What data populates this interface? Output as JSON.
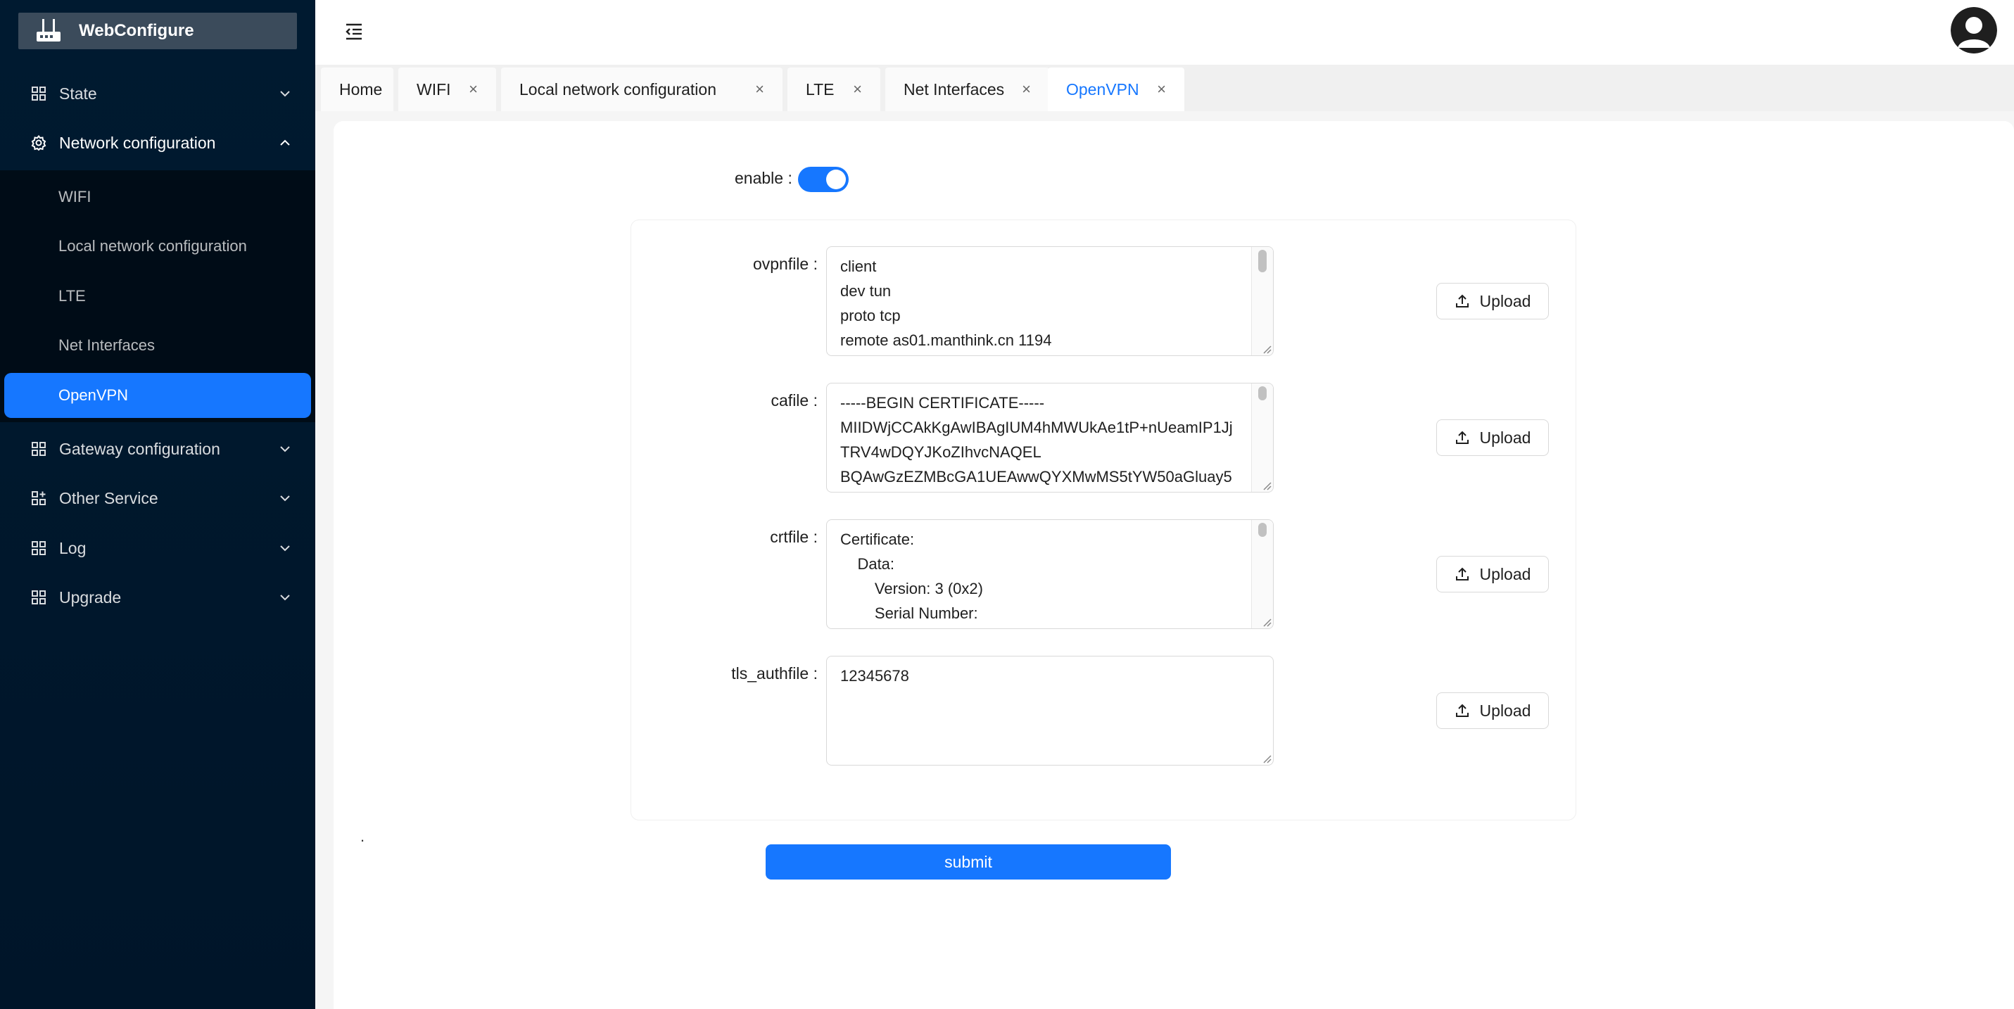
{
  "app": {
    "title": "WebConfigure"
  },
  "sidebar": {
    "menu": [
      {
        "label": "State",
        "expanded": false
      },
      {
        "label": "Network configuration",
        "expanded": true
      },
      {
        "label": "Gateway configuration",
        "expanded": false
      },
      {
        "label": "Other Service",
        "expanded": false
      },
      {
        "label": "Log",
        "expanded": false
      },
      {
        "label": "Upgrade",
        "expanded": false
      }
    ],
    "network_submenu": [
      {
        "label": "WIFI"
      },
      {
        "label": "Local network configuration"
      },
      {
        "label": "LTE"
      },
      {
        "label": "Net Interfaces"
      },
      {
        "label": "OpenVPN",
        "active": true
      }
    ]
  },
  "tabs": [
    {
      "label": "Home",
      "closable": false
    },
    {
      "label": "WIFI",
      "closable": true
    },
    {
      "label": "Local network configuration",
      "closable": true
    },
    {
      "label": "LTE",
      "closable": true
    },
    {
      "label": "Net Interfaces",
      "closable": true
    },
    {
      "label": "OpenVPN",
      "closable": true,
      "active": true
    }
  ],
  "tab_close_glyph": "×",
  "form": {
    "enable_label": "enable :",
    "enable_value": true,
    "fields": [
      {
        "label": "ovpnfile :",
        "value": "client\ndev tun\nproto tcp\nremote as01.manthink.cn 1194"
      },
      {
        "label": "cafile :",
        "value": "-----BEGIN CERTIFICATE-----\nMIIDWjCCAkKgAwIBAgIUM4hMWUkAe1tP+nUeamIP1Jj\nTRV4wDQYJKoZIhvcNAQEL\nBQAwGzEZMBcGA1UEAwwQYXMwMS5tYW50aGluay5"
      },
      {
        "label": "crtfile :",
        "value": "Certificate:\n    Data:\n        Version: 3 (0x2)\n        Serial Number:"
      },
      {
        "label": "tls_authfile :",
        "value": "12345678"
      }
    ],
    "upload_label": "Upload",
    "submit_label": "submit",
    "stray_text": "."
  },
  "colors": {
    "primary": "#1677ff",
    "sidebar_bg": "#001529",
    "submenu_bg": "#000c17"
  },
  "icons": {
    "logo": "router-icon",
    "menu": "grid-icon",
    "network": "gear-icon",
    "header": "menu-fold-icon",
    "avatar": "user-avatar-icon",
    "upload": "upload-icon"
  }
}
